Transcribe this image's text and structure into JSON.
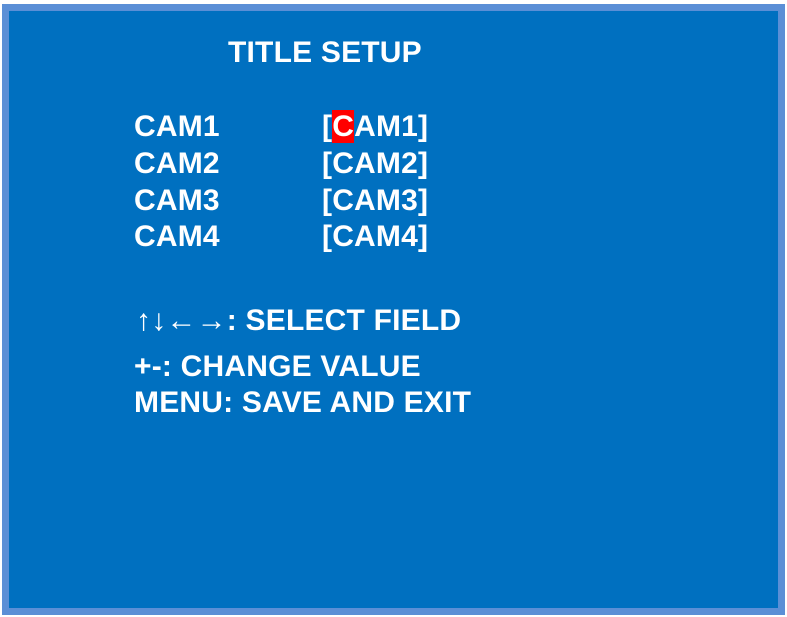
{
  "screen": {
    "title": "TITLE SETUP"
  },
  "cameras": [
    {
      "label": "CAM1",
      "open": "[",
      "cursor": "C",
      "rest": "AM1]"
    },
    {
      "label": "CAM2",
      "value": "[CAM2]"
    },
    {
      "label": "CAM3",
      "value": "[CAM3]"
    },
    {
      "label": "CAM4",
      "value": "[CAM4]"
    }
  ],
  "help": {
    "select": "↑↓←→: SELECT FIELD",
    "change": "+-: CHANGE VALUE",
    "save": "MENU: SAVE AND EXIT"
  },
  "colors": {
    "background": "#0070c0",
    "border": "#5b8fd6",
    "text": "#ffffff",
    "cursor": "#ff0000"
  }
}
